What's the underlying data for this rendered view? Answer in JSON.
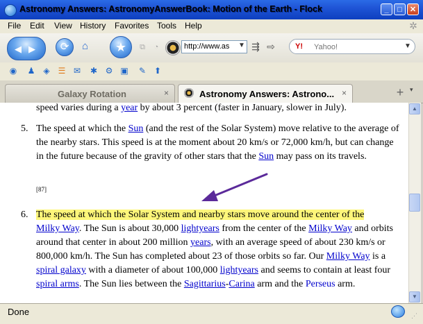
{
  "window": {
    "title": "Astronomy Answers: AstronomyAnswerBook: Motion of the Earth - Flock",
    "minimize": "_",
    "maximize": "□",
    "close": "✕"
  },
  "menu": [
    "File",
    "Edit",
    "View",
    "History",
    "Favorites",
    "Tools",
    "Help"
  ],
  "nav": {
    "back": "◀",
    "forward": "▶",
    "reload": "⟳",
    "home": "⌂",
    "star": "★",
    "url": "http://www.as",
    "url_dropdown": "▼",
    "search_placeholder": "Yahoo!",
    "search_engine": "Y!",
    "search_dropdown": "▼"
  },
  "social_icons": [
    "flock-icon",
    "people-icon",
    "media-icon",
    "feeds-icon",
    "mail-icon",
    "accounts-icon",
    "web-clipboard-icon",
    "upload-icon",
    "blog-icon",
    "share-icon"
  ],
  "tabs": [
    {
      "label": "Galaxy Rotation",
      "close": "×",
      "active": false
    },
    {
      "label": "Astronomy Answers: Astrono...",
      "close": "×",
      "active": true
    }
  ],
  "tab_new": "+",
  "tab_menu": "▾",
  "content": {
    "p4_tail": {
      "pre": "speed varies during a ",
      "link": "year",
      "post": " by about 3 percent (faster in January, slower in July)."
    },
    "item5": {
      "num": "5.",
      "t1": "The speed at which the ",
      "l_sun": "Sun",
      "t2": " (and the rest of the Solar System) move relative to the average of the nearby stars. This speed is at the moment about 20 km/s or 72,000 km/h, but can change in the future because of the gravity of other stars that the ",
      "l_sun2": "Sun",
      "t3": " may pass on its travels."
    },
    "ref": "[87]",
    "item6": {
      "num": "6.",
      "hl": "The speed at which the Solar System and nearby stars move around the center of the",
      "l_milky": "Milky Way",
      "t1": ". The Sun is about 30,000 ",
      "l_ly": "lightyears",
      "t2": " from the center of the ",
      "l_milky2": "Milky Way",
      "t3": " and orbits around that center in about 200 million ",
      "l_years": "years",
      "t4": ", with an average speed of about 230 km/s or 800,000 km/h. The Sun has completed about 23 of those orbits so far. Our ",
      "l_milky3": "Milky Way",
      "t5": " is a ",
      "l_spiral": "spiral galaxy",
      "t6": " with a diameter of about 100,000 ",
      "l_ly2": "lightyears",
      "t7": " and seems to contain at least four ",
      "l_arms": "spiral arms",
      "t8": ". The Sun lies between the ",
      "l_sag": "Sagittarius",
      "dash": "-",
      "l_car": "Carina",
      "t9": " arm and the ",
      "l_per": "Perseus",
      "t10": " arm."
    }
  },
  "status": {
    "text": "Done"
  },
  "colors": {
    "title_bar": "#1f55d6",
    "highlight": "#fdf67a",
    "link": "#0000cc",
    "arrow": "#5b2a9a"
  }
}
